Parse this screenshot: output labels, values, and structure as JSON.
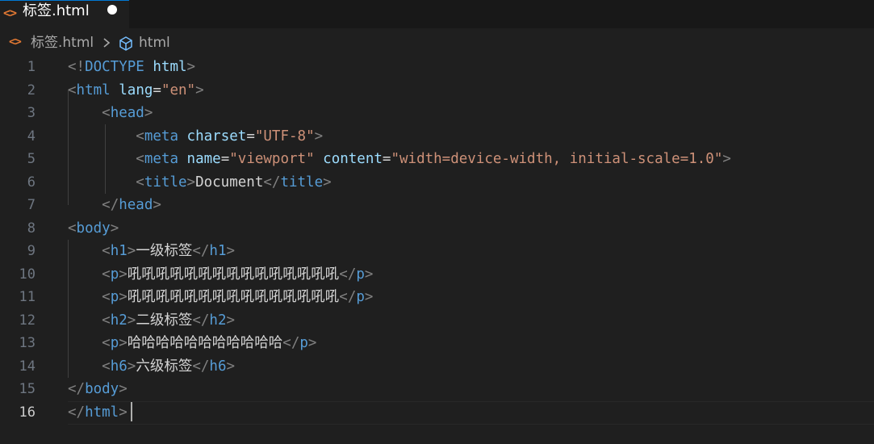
{
  "tab": {
    "icon": "html-code-icon",
    "label": "标签.html",
    "modified": true
  },
  "breadcrumb": {
    "file_icon": "html-code-icon",
    "file": "标签.html",
    "separator_icon": "chevron-right-icon",
    "symbol_icon": "cube-icon",
    "symbol": "html"
  },
  "editor": {
    "current_line": 16,
    "lines": [
      {
        "number": "1",
        "tokens": [
          [
            "br",
            "<!"
          ],
          [
            "tag",
            "DOCTYPE"
          ],
          [
            "txt",
            " "
          ],
          [
            "attr",
            "html"
          ],
          [
            "br",
            ">"
          ]
        ]
      },
      {
        "number": "2",
        "tokens": [
          [
            "br",
            "<"
          ],
          [
            "tag",
            "html"
          ],
          [
            "txt",
            " "
          ],
          [
            "attr",
            "lang"
          ],
          [
            "eq",
            "="
          ],
          [
            "str",
            "\"en\""
          ],
          [
            "br",
            ">"
          ]
        ]
      },
      {
        "number": "3",
        "tokens": [
          [
            "txt",
            "    "
          ],
          [
            "br",
            "<"
          ],
          [
            "tag",
            "head"
          ],
          [
            "br",
            ">"
          ]
        ]
      },
      {
        "number": "4",
        "tokens": [
          [
            "txt",
            "        "
          ],
          [
            "br",
            "<"
          ],
          [
            "tag",
            "meta"
          ],
          [
            "txt",
            " "
          ],
          [
            "attr",
            "charset"
          ],
          [
            "eq",
            "="
          ],
          [
            "str",
            "\"UTF-8\""
          ],
          [
            "br",
            ">"
          ]
        ]
      },
      {
        "number": "5",
        "tokens": [
          [
            "txt",
            "        "
          ],
          [
            "br",
            "<"
          ],
          [
            "tag",
            "meta"
          ],
          [
            "txt",
            " "
          ],
          [
            "attr",
            "name"
          ],
          [
            "eq",
            "="
          ],
          [
            "str",
            "\"viewport\""
          ],
          [
            "txt",
            " "
          ],
          [
            "attr",
            "content"
          ],
          [
            "eq",
            "="
          ],
          [
            "str",
            "\"width=device-width, initial-scale=1.0\""
          ],
          [
            "br",
            ">"
          ]
        ]
      },
      {
        "number": "6",
        "tokens": [
          [
            "txt",
            "        "
          ],
          [
            "br",
            "<"
          ],
          [
            "tag",
            "title"
          ],
          [
            "br",
            ">"
          ],
          [
            "txt",
            "Document"
          ],
          [
            "br",
            "</"
          ],
          [
            "tag",
            "title"
          ],
          [
            "br",
            ">"
          ]
        ]
      },
      {
        "number": "7",
        "tokens": [
          [
            "txt",
            "    "
          ],
          [
            "br",
            "</"
          ],
          [
            "tag",
            "head"
          ],
          [
            "br",
            ">"
          ]
        ]
      },
      {
        "number": "8",
        "tokens": [
          [
            "br",
            "<"
          ],
          [
            "tag",
            "body"
          ],
          [
            "br",
            ">"
          ]
        ]
      },
      {
        "number": "9",
        "tokens": [
          [
            "txt",
            "    "
          ],
          [
            "br",
            "<"
          ],
          [
            "tag",
            "h1"
          ],
          [
            "br",
            ">"
          ],
          [
            "txt",
            "一级标签"
          ],
          [
            "br",
            "</"
          ],
          [
            "tag",
            "h1"
          ],
          [
            "br",
            ">"
          ]
        ]
      },
      {
        "number": "10",
        "tokens": [
          [
            "txt",
            "    "
          ],
          [
            "br",
            "<"
          ],
          [
            "tag",
            "p"
          ],
          [
            "br",
            ">"
          ],
          [
            "txt",
            "吼吼吼吼吼吼吼吼吼吼吼吼吼吼吼"
          ],
          [
            "br",
            "</"
          ],
          [
            "tag",
            "p"
          ],
          [
            "br",
            ">"
          ]
        ]
      },
      {
        "number": "11",
        "tokens": [
          [
            "txt",
            "    "
          ],
          [
            "br",
            "<"
          ],
          [
            "tag",
            "p"
          ],
          [
            "br",
            ">"
          ],
          [
            "txt",
            "吼吼吼吼吼吼吼吼吼吼吼吼吼吼吼"
          ],
          [
            "br",
            "</"
          ],
          [
            "tag",
            "p"
          ],
          [
            "br",
            ">"
          ]
        ]
      },
      {
        "number": "12",
        "tokens": [
          [
            "txt",
            "    "
          ],
          [
            "br",
            "<"
          ],
          [
            "tag",
            "h2"
          ],
          [
            "br",
            ">"
          ],
          [
            "txt",
            "二级标签"
          ],
          [
            "br",
            "</"
          ],
          [
            "tag",
            "h2"
          ],
          [
            "br",
            ">"
          ]
        ]
      },
      {
        "number": "13",
        "tokens": [
          [
            "txt",
            "    "
          ],
          [
            "br",
            "<"
          ],
          [
            "tag",
            "p"
          ],
          [
            "br",
            ">"
          ],
          [
            "txt",
            "哈哈哈哈哈哈哈哈哈哈哈"
          ],
          [
            "br",
            "</"
          ],
          [
            "tag",
            "p"
          ],
          [
            "br",
            ">"
          ]
        ]
      },
      {
        "number": "14",
        "tokens": [
          [
            "txt",
            "    "
          ],
          [
            "br",
            "<"
          ],
          [
            "tag",
            "h6"
          ],
          [
            "br",
            ">"
          ],
          [
            "txt",
            "六级标签"
          ],
          [
            "br",
            "</"
          ],
          [
            "tag",
            "h6"
          ],
          [
            "br",
            ">"
          ]
        ]
      },
      {
        "number": "15",
        "tokens": [
          [
            "br",
            "</"
          ],
          [
            "tag",
            "body"
          ],
          [
            "br",
            ">"
          ]
        ]
      },
      {
        "number": "16",
        "tokens": [
          [
            "br",
            "</"
          ],
          [
            "tag",
            "html"
          ],
          [
            "br",
            ">"
          ]
        ]
      }
    ]
  }
}
